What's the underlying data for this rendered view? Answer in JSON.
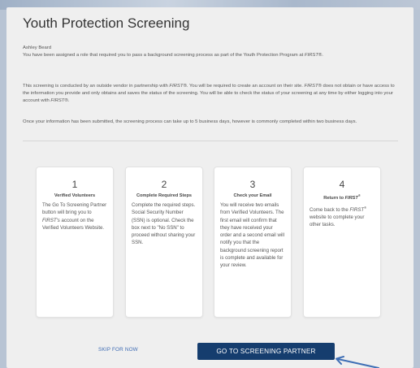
{
  "header": {
    "title": "Youth Protection Screening"
  },
  "intro": {
    "user_name": "Ashley Beard",
    "p1_a": "You have been assigned a role that required you to pass a background screening process as part of the Youth Protection Program at ",
    "p1_first": "FIRST®",
    "p1_b": ".",
    "p2_a": "This screening is conducted by an outside vendor in partnership with ",
    "p2_first1": "FIRST®",
    "p2_b": ". You will be required to create an account on their site. ",
    "p2_first2": "FIRST®",
    "p2_c": " does not obtain or have access to the information you provide and only obtains and saves the status of the screening. You will be able to check the status of your screening at any time by either logging into your account with ",
    "p2_first3": "FIRST®",
    "p2_d": ".",
    "p3": "Once your information has been submitted, the screening process can take up to 5 business days, however is commonly completed within two business days."
  },
  "steps": [
    {
      "number": "1",
      "title": "Verified Volunteers",
      "body_a": "The Go To Screening Partner button will bring you to ",
      "body_first": "FIRST's",
      "body_b": " account on the Verified Volunteers Website."
    },
    {
      "number": "2",
      "title": "Complete Required Steps",
      "body": "Complete the required steps. Social Security Number (SSN) is optional. Check the box next to \"No SSN\" to proceed without sharing your SSN."
    },
    {
      "number": "3",
      "title": "Check your Email",
      "body": "You will receive two emails from Verified Volunteers. The first email will confirm that they have received your order and a second email will notify you that the background screening report is complete and available for your review."
    },
    {
      "number": "4",
      "title_a": "Return to ",
      "title_first": "FIRST",
      "title_sup": "®",
      "body_a": "Come back to the ",
      "body_first": "FIRST",
      "body_sup": "®",
      "body_b": " website to complete your other tasks."
    }
  ],
  "actions": {
    "skip_label": "SKIP FOR NOW",
    "go_label": "GO TO SCREENING PARTNER"
  },
  "colors": {
    "primary_button": "#153d6e",
    "link": "#3d6bb3",
    "arrow": "#3f6fb5"
  }
}
